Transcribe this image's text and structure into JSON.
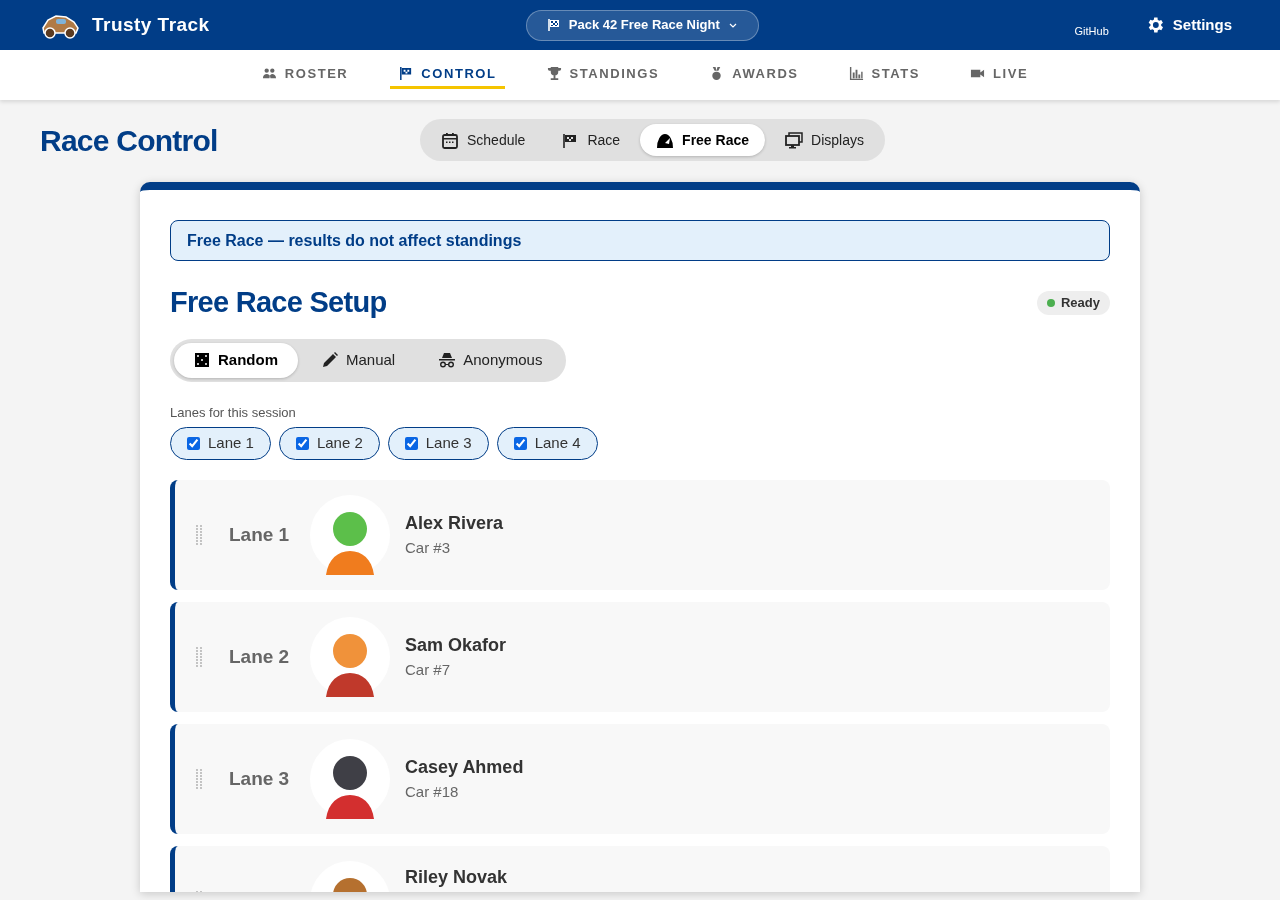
{
  "header": {
    "brand": "Trusty Track",
    "event_selector": "Pack 42 Free Race Night",
    "links": [
      {
        "label": "GitHub"
      },
      {
        "label": "Settings"
      }
    ]
  },
  "nav_tabs": [
    {
      "label": "ROSTER",
      "selected": false
    },
    {
      "label": "CONTROL",
      "selected": true
    },
    {
      "label": "STANDINGS",
      "selected": false
    },
    {
      "label": "AWARDS",
      "selected": false
    },
    {
      "label": "STATS",
      "selected": false
    },
    {
      "label": "LIVE",
      "selected": false
    }
  ],
  "page_title": "Race Control",
  "mode_tabs": [
    {
      "label": "Schedule",
      "selected": false
    },
    {
      "label": "Race",
      "selected": false
    },
    {
      "label": "Free Race",
      "selected": true
    },
    {
      "label": "Displays",
      "selected": false
    }
  ],
  "notice": "Free Race — results do not affect standings",
  "setup": {
    "title": "Free Race Setup",
    "status": {
      "label": "Ready",
      "color": "#4caf50"
    },
    "assign_modes": [
      {
        "label": "Random",
        "selected": true
      },
      {
        "label": "Manual",
        "selected": false
      },
      {
        "label": "Anonymous",
        "selected": false
      }
    ],
    "lanes_label": "Lanes for this session",
    "lanes": [
      {
        "label": "Lane 1",
        "checked": true
      },
      {
        "label": "Lane 2",
        "checked": true
      },
      {
        "label": "Lane 3",
        "checked": true
      },
      {
        "label": "Lane 4",
        "checked": true
      }
    ],
    "assignments": [
      {
        "lane": "Lane 1",
        "name": "Alex Rivera",
        "car": "Car #3"
      },
      {
        "lane": "Lane 2",
        "name": "Sam Okafor",
        "car": "Car #7"
      },
      {
        "lane": "Lane 3",
        "name": "Casey Ahmed",
        "car": "Car #18"
      },
      {
        "name": "Riley Novak"
      }
    ]
  }
}
